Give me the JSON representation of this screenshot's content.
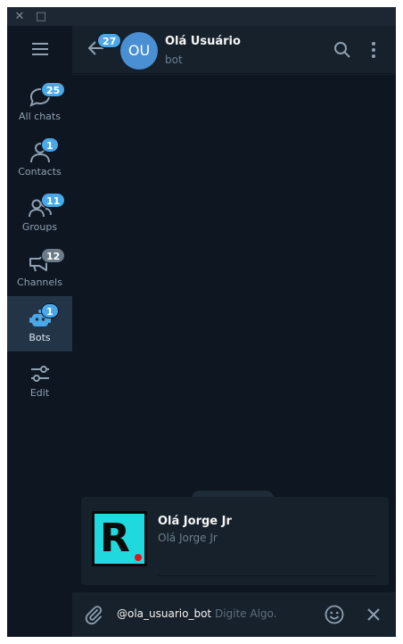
{
  "window": {
    "close_glyph": "✕",
    "maximize_glyph": "□"
  },
  "sidebar": {
    "folders": [
      {
        "label": "All chats",
        "badge": "25",
        "badge_style": "accent",
        "icon": "chats-icon"
      },
      {
        "label": "Contacts",
        "badge": "1",
        "badge_style": "accent",
        "icon": "contact-icon"
      },
      {
        "label": "Groups",
        "badge": "11",
        "badge_style": "accent",
        "icon": "groups-icon"
      },
      {
        "label": "Channels",
        "badge": "12",
        "badge_style": "muted",
        "icon": "channels-icon"
      },
      {
        "label": "Bots",
        "badge": "1",
        "badge_style": "accent",
        "icon": "bots-icon",
        "active": true
      },
      {
        "label": "Edit",
        "icon": "edit-filters-icon"
      }
    ]
  },
  "header": {
    "back_badge": "27",
    "avatar_initials": "OU",
    "title": "Olá Usuário",
    "subtitle": "bot"
  },
  "inline_results": [
    {
      "title": "Olá Jorge Jr",
      "description": "Olá Jorge Jr",
      "thumb_letter": "R"
    }
  ],
  "composer": {
    "bot_username": "@ola_usuario_bot",
    "placeholder": "Digite Algo."
  },
  "colors": {
    "accent": "#4aa7e8",
    "sidebar_bg": "#0e1621",
    "panel_bg": "#17212b",
    "active_folder_bg": "#243447",
    "avatar_bg": "#4a8fd4"
  }
}
